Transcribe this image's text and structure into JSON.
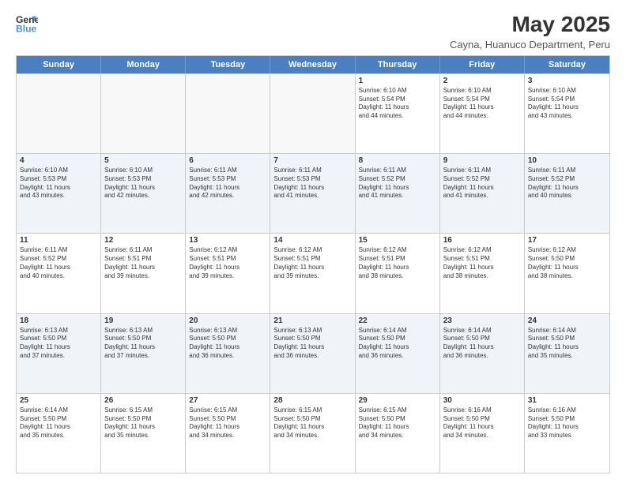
{
  "logo": {
    "general": "General",
    "blue": "Blue"
  },
  "title": "May 2025",
  "subtitle": "Cayna, Huanuco Department, Peru",
  "header_days": [
    "Sunday",
    "Monday",
    "Tuesday",
    "Wednesday",
    "Thursday",
    "Friday",
    "Saturday"
  ],
  "weeks": [
    [
      {
        "day": "",
        "text": "",
        "empty": true
      },
      {
        "day": "",
        "text": "",
        "empty": true
      },
      {
        "day": "",
        "text": "",
        "empty": true
      },
      {
        "day": "",
        "text": "",
        "empty": true
      },
      {
        "day": "1",
        "text": "Sunrise: 6:10 AM\nSunset: 5:54 PM\nDaylight: 11 hours\nand 44 minutes.",
        "empty": false
      },
      {
        "day": "2",
        "text": "Sunrise: 6:10 AM\nSunset: 5:54 PM\nDaylight: 11 hours\nand 44 minutes.",
        "empty": false
      },
      {
        "day": "3",
        "text": "Sunrise: 6:10 AM\nSunset: 5:54 PM\nDaylight: 11 hours\nand 43 minutes.",
        "empty": false
      }
    ],
    [
      {
        "day": "4",
        "text": "Sunrise: 6:10 AM\nSunset: 5:53 PM\nDaylight: 11 hours\nand 43 minutes.",
        "empty": false
      },
      {
        "day": "5",
        "text": "Sunrise: 6:10 AM\nSunset: 5:53 PM\nDaylight: 11 hours\nand 42 minutes.",
        "empty": false
      },
      {
        "day": "6",
        "text": "Sunrise: 6:11 AM\nSunset: 5:53 PM\nDaylight: 11 hours\nand 42 minutes.",
        "empty": false
      },
      {
        "day": "7",
        "text": "Sunrise: 6:11 AM\nSunset: 5:53 PM\nDaylight: 11 hours\nand 41 minutes.",
        "empty": false
      },
      {
        "day": "8",
        "text": "Sunrise: 6:11 AM\nSunset: 5:52 PM\nDaylight: 11 hours\nand 41 minutes.",
        "empty": false
      },
      {
        "day": "9",
        "text": "Sunrise: 6:11 AM\nSunset: 5:52 PM\nDaylight: 11 hours\nand 41 minutes.",
        "empty": false
      },
      {
        "day": "10",
        "text": "Sunrise: 6:11 AM\nSunset: 5:52 PM\nDaylight: 11 hours\nand 40 minutes.",
        "empty": false
      }
    ],
    [
      {
        "day": "11",
        "text": "Sunrise: 6:11 AM\nSunset: 5:52 PM\nDaylight: 11 hours\nand 40 minutes.",
        "empty": false
      },
      {
        "day": "12",
        "text": "Sunrise: 6:11 AM\nSunset: 5:51 PM\nDaylight: 11 hours\nand 39 minutes.",
        "empty": false
      },
      {
        "day": "13",
        "text": "Sunrise: 6:12 AM\nSunset: 5:51 PM\nDaylight: 11 hours\nand 39 minutes.",
        "empty": false
      },
      {
        "day": "14",
        "text": "Sunrise: 6:12 AM\nSunset: 5:51 PM\nDaylight: 11 hours\nand 39 minutes.",
        "empty": false
      },
      {
        "day": "15",
        "text": "Sunrise: 6:12 AM\nSunset: 5:51 PM\nDaylight: 11 hours\nand 38 minutes.",
        "empty": false
      },
      {
        "day": "16",
        "text": "Sunrise: 6:12 AM\nSunset: 5:51 PM\nDaylight: 11 hours\nand 38 minutes.",
        "empty": false
      },
      {
        "day": "17",
        "text": "Sunrise: 6:12 AM\nSunset: 5:50 PM\nDaylight: 11 hours\nand 38 minutes.",
        "empty": false
      }
    ],
    [
      {
        "day": "18",
        "text": "Sunrise: 6:13 AM\nSunset: 5:50 PM\nDaylight: 11 hours\nand 37 minutes.",
        "empty": false
      },
      {
        "day": "19",
        "text": "Sunrise: 6:13 AM\nSunset: 5:50 PM\nDaylight: 11 hours\nand 37 minutes.",
        "empty": false
      },
      {
        "day": "20",
        "text": "Sunrise: 6:13 AM\nSunset: 5:50 PM\nDaylight: 11 hours\nand 36 minutes.",
        "empty": false
      },
      {
        "day": "21",
        "text": "Sunrise: 6:13 AM\nSunset: 5:50 PM\nDaylight: 11 hours\nand 36 minutes.",
        "empty": false
      },
      {
        "day": "22",
        "text": "Sunrise: 6:14 AM\nSunset: 5:50 PM\nDaylight: 11 hours\nand 36 minutes.",
        "empty": false
      },
      {
        "day": "23",
        "text": "Sunrise: 6:14 AM\nSunset: 5:50 PM\nDaylight: 11 hours\nand 36 minutes.",
        "empty": false
      },
      {
        "day": "24",
        "text": "Sunrise: 6:14 AM\nSunset: 5:50 PM\nDaylight: 11 hours\nand 35 minutes.",
        "empty": false
      }
    ],
    [
      {
        "day": "25",
        "text": "Sunrise: 6:14 AM\nSunset: 5:50 PM\nDaylight: 11 hours\nand 35 minutes.",
        "empty": false
      },
      {
        "day": "26",
        "text": "Sunrise: 6:15 AM\nSunset: 5:50 PM\nDaylight: 11 hours\nand 35 minutes.",
        "empty": false
      },
      {
        "day": "27",
        "text": "Sunrise: 6:15 AM\nSunset: 5:50 PM\nDaylight: 11 hours\nand 34 minutes.",
        "empty": false
      },
      {
        "day": "28",
        "text": "Sunrise: 6:15 AM\nSunset: 5:50 PM\nDaylight: 11 hours\nand 34 minutes.",
        "empty": false
      },
      {
        "day": "29",
        "text": "Sunrise: 6:15 AM\nSunset: 5:50 PM\nDaylight: 11 hours\nand 34 minutes.",
        "empty": false
      },
      {
        "day": "30",
        "text": "Sunrise: 6:16 AM\nSunset: 5:50 PM\nDaylight: 11 hours\nand 34 minutes.",
        "empty": false
      },
      {
        "day": "31",
        "text": "Sunrise: 6:16 AM\nSunset: 5:50 PM\nDaylight: 11 hours\nand 33 minutes.",
        "empty": false
      }
    ]
  ]
}
